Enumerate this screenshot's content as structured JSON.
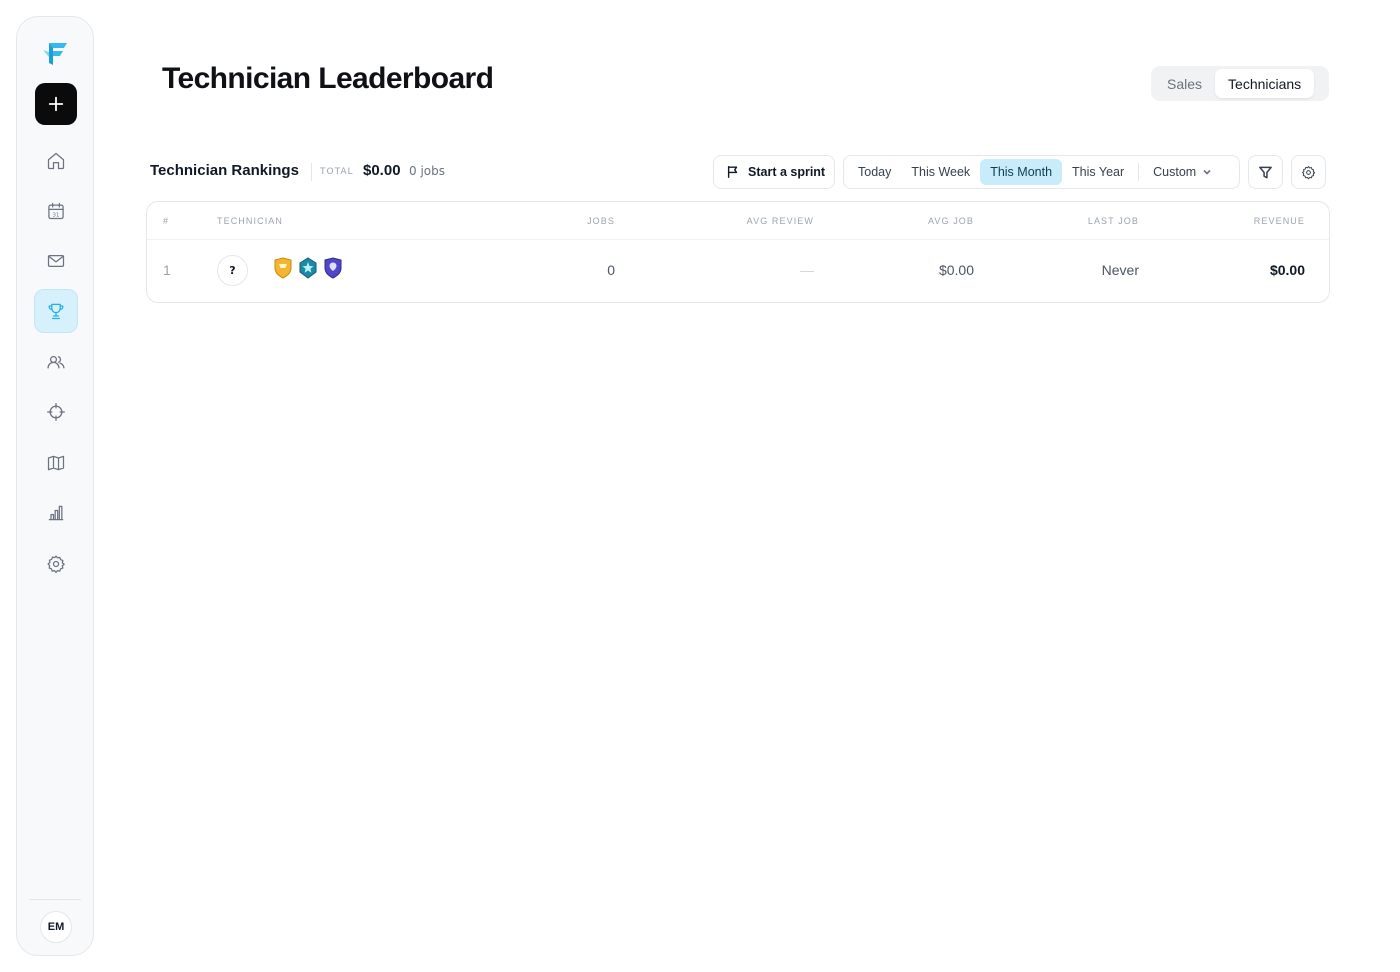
{
  "sidebar": {
    "new_button_icon": "plus-icon",
    "items": [
      {
        "name": "home",
        "icon": "home-icon",
        "active": false
      },
      {
        "name": "calendar",
        "icon": "calendar-icon",
        "calendar_day": "31",
        "active": false
      },
      {
        "name": "inbox",
        "icon": "mail-icon",
        "active": false
      },
      {
        "name": "leaderboard",
        "icon": "trophy-icon",
        "active": true
      },
      {
        "name": "customers",
        "icon": "users-icon",
        "active": false
      },
      {
        "name": "dispatch",
        "icon": "crosshair-icon",
        "active": false
      },
      {
        "name": "map",
        "icon": "map-icon",
        "active": false
      },
      {
        "name": "reports",
        "icon": "bar-chart-icon",
        "active": false
      },
      {
        "name": "settings",
        "icon": "gear-icon",
        "active": false
      }
    ],
    "user_initials": "EM"
  },
  "header": {
    "title": "Technician Leaderboard",
    "tabs": [
      {
        "label": "Sales",
        "active": false
      },
      {
        "label": "Technicians",
        "active": true
      }
    ]
  },
  "toolbar": {
    "section_title": "Technician Rankings",
    "total_label": "TOTAL",
    "total_value": "$0.00",
    "total_jobs": "0 jobs",
    "sprint_label": "Start a sprint",
    "ranges": [
      {
        "label": "Today",
        "active": false
      },
      {
        "label": "This Week",
        "active": false
      },
      {
        "label": "This Month",
        "active": true
      },
      {
        "label": "This Year",
        "active": false
      }
    ],
    "custom_label": "Custom"
  },
  "table": {
    "columns": [
      "#",
      "TECHNICIAN",
      "JOBS",
      "AVG REVIEW",
      "AVG JOB",
      "LAST JOB",
      "REVENUE"
    ],
    "rows": [
      {
        "rank": "1",
        "avatar": "?",
        "badges": [
          "gold-shield-badge",
          "teal-gem-badge",
          "indigo-shield-badge"
        ],
        "jobs": "0",
        "avg_review": "—",
        "avg_job": "$0.00",
        "last_job": "Never",
        "revenue": "$0.00"
      }
    ]
  },
  "colors": {
    "accent": "#22b0e6",
    "active_range_bg": "#c9ecfb",
    "primary_button": "#0b0b0c"
  }
}
